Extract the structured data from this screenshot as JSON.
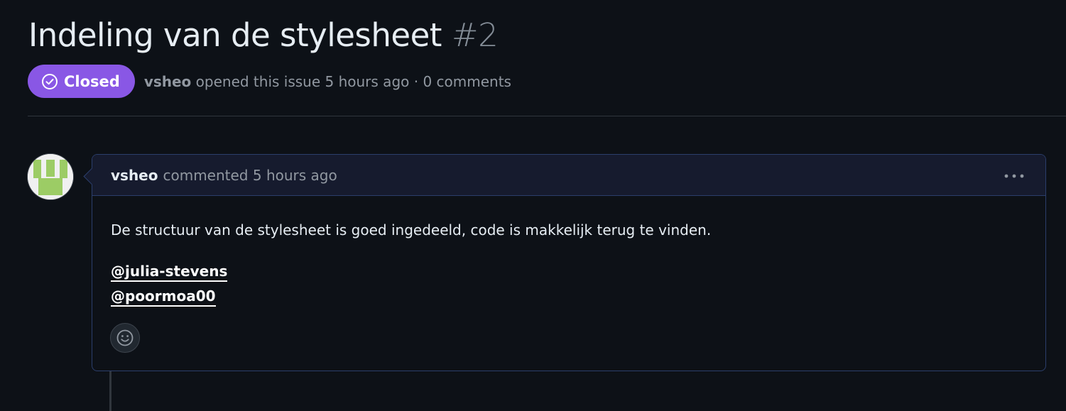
{
  "issue": {
    "title": "Indeling van de stylesheet",
    "number": "#2",
    "state": "Closed",
    "author": "vsheo",
    "opened_text": "opened this issue 5 hours ago · 0 comments"
  },
  "comment": {
    "author": "vsheo",
    "action": "commented 5 hours ago",
    "body": "De structuur van de stylesheet is goed ingedeeld, code is makkelijk terug te vinden.",
    "mentions": [
      "@julia-stevens",
      "@poormoa00"
    ]
  },
  "icons": {
    "state": "check-circle-icon",
    "menu": "kebab-horizontal-icon",
    "reaction": "smiley-icon"
  },
  "colors": {
    "background": "#0d1117",
    "closed_badge": "#8957e5",
    "comment_header": "#161b2e",
    "comment_border": "#2b3e6b",
    "muted_text": "#9198a1",
    "avatar_green": "#9ccc65"
  }
}
